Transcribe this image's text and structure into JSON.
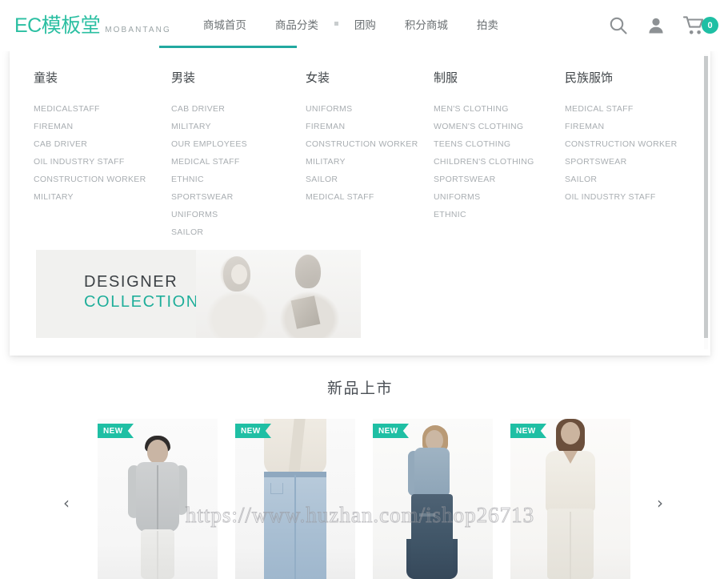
{
  "header": {
    "logo_main": "EC模板堂",
    "logo_sub": "MOBANTANG",
    "nav": [
      {
        "label": "商城首页",
        "active": true
      },
      {
        "label": "商品分类",
        "active": true
      },
      {
        "label": "团购",
        "active": false
      },
      {
        "label": "积分商城",
        "active": false
      },
      {
        "label": "拍卖",
        "active": false
      }
    ],
    "icons": {
      "search": "search-icon",
      "account": "user-icon",
      "cart": "cart-icon"
    },
    "cart_count": "0",
    "accent_color": "#1fbfa4",
    "underline_color": "#22a9a0"
  },
  "dropdown": {
    "columns": [
      {
        "title": "童装",
        "links": [
          "MEDICALSTAFF",
          "FIREMAN",
          "CAB DRIVER",
          "OIL INDUSTRY STAFF",
          "CONSTRUCTION WORKER",
          "MILITARY"
        ]
      },
      {
        "title": "男装",
        "links": [
          "CAB DRIVER",
          "MILITARY",
          "OUR EMPLOYEES",
          "MEDICAL STAFF",
          "ETHNIC",
          "SPORTSWEAR",
          "UNIFORMS",
          "SAILOR"
        ]
      },
      {
        "title": "女装",
        "links": [
          "UNIFORMS",
          "FIREMAN",
          "CONSTRUCTION WORKER",
          "MILITARY",
          "SAILOR",
          "MEDICAL STAFF"
        ]
      },
      {
        "title": "制服",
        "links": [
          "MEN'S CLOTHING",
          "WOMEN'S CLOTHING",
          "TEENS CLOTHING",
          "CHILDREN'S CLOTHING",
          "SPORTSWEAR",
          "UNIFORMS",
          "ETHNIC"
        ]
      },
      {
        "title": "民族服饰",
        "links": [
          "MEDICAL STAFF",
          "FIREMAN",
          "CONSTRUCTION WORKER",
          "SPORTSWEAR",
          "SAILOR",
          "OIL INDUSTRY STAFF"
        ]
      }
    ],
    "banner": {
      "line1": "DESIGNER",
      "line2": "COLLECTIONS",
      "line1_color": "#3c4145",
      "line2_color": "#1fae9a"
    }
  },
  "new_arrivals": {
    "section_title": "新品上市",
    "badge_label": "NEW",
    "prev_arrow": "‹",
    "next_arrow": "›",
    "products": [
      {
        "badge": "NEW",
        "alt": "man-gray-shirt-white-trousers"
      },
      {
        "badge": "NEW",
        "alt": "light-blue-flared-jeans-cream-blouse"
      },
      {
        "badge": "NEW",
        "alt": "denim-jacket-dark-flared-jeans"
      },
      {
        "badge": "NEW",
        "alt": "cream-sleeveless-top-white-trousers"
      }
    ]
  },
  "watermark": {
    "text": "https://www.huzhan.com/ishop26713"
  }
}
